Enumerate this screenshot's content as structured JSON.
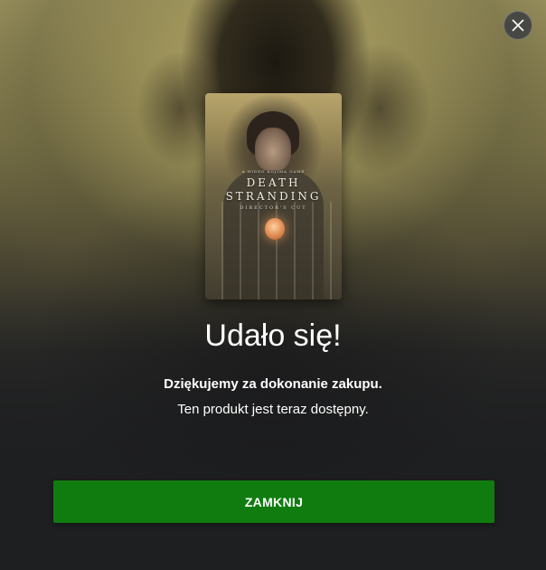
{
  "dialog": {
    "title": "Udało się!",
    "subtitle": "Dziękujemy za dokonanie zakupu.",
    "message": "Ten produkt jest teraz dostępny.",
    "close_button_label": "ZAMKNIJ",
    "close_icon": "close-icon"
  },
  "product": {
    "cover_kicker": "A HIDEO KOJIMA GAME",
    "cover_title_line1": "DEATH",
    "cover_title_line2": "STRANDING",
    "cover_title_line3": "DIRECTOR'S CUT"
  },
  "colors": {
    "accent_green": "#107c10",
    "background": "#1e1f21",
    "text": "#ffffff"
  }
}
